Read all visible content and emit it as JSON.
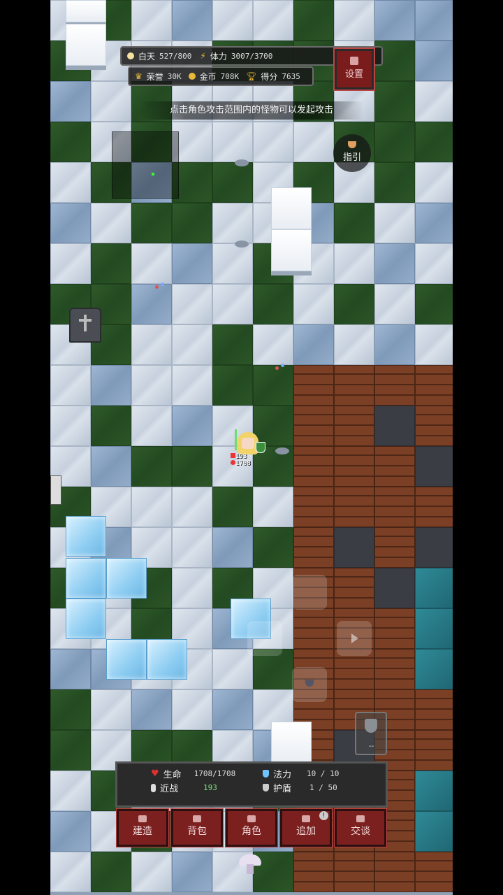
{
  "hud": {
    "time_label": "白天",
    "time_value": "527/800",
    "stamina_label": "体力",
    "stamina_value": "3007/3700",
    "honor_label": "荣誉",
    "honor_value": "30K",
    "gold_label": "金币",
    "gold_value": "708K",
    "score_label": "得分",
    "score_value": "7635",
    "settings_label": "设置"
  },
  "hint_text": "点击角色攻击范围内的怪物可以发起攻击",
  "guide_label": "指引",
  "player": {
    "level_badge": "193",
    "hp_badge": "1708"
  },
  "shield_slot_text": "--",
  "stats": {
    "hp_label": "生命",
    "hp_value": "1708/1708",
    "mana_label": "法力",
    "mana_value": "10 / 10",
    "melee_label": "近战",
    "melee_value": "193",
    "shield_label": "护盾",
    "shield_value": "1 / 50"
  },
  "menu": [
    {
      "label": "建造"
    },
    {
      "label": "背包"
    },
    {
      "label": "角色"
    },
    {
      "label": "追加",
      "badge": "!"
    },
    {
      "label": "交谈"
    }
  ],
  "colors": {
    "menu_red": "#7b1f1f",
    "hp_heart": "#e03030",
    "mana_blue": "#6fc3ff",
    "gold": "#e7b93a"
  }
}
